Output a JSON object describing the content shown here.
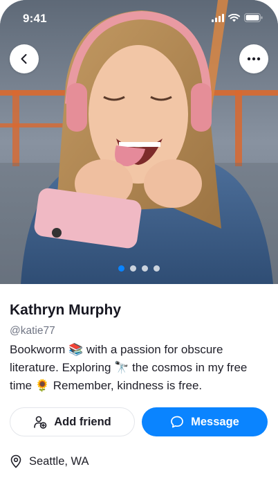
{
  "status_bar": {
    "time": "9:41"
  },
  "photo": {
    "carousel_dot_count": 4,
    "active_dot": 1
  },
  "profile": {
    "name": "Kathryn Murphy",
    "handle": "@katie77",
    "bio": "Bookworm 📚 with a passion for obscure literature. Exploring 🔭 the cosmos in my free time 🌻 Remember, kindness is free.",
    "location": "Seattle, WA"
  },
  "actions": {
    "add_friend_label": "Add friend",
    "message_label": "Message"
  },
  "colors": {
    "accent": "#0a84ff",
    "text_primary": "#171721",
    "text_secondary": "#707584"
  },
  "icons": {
    "back": "chevron-left-icon",
    "more": "ellipsis-icon",
    "add_friend": "user-plus-icon",
    "message": "chat-bubble-icon",
    "location": "map-pin-icon"
  }
}
